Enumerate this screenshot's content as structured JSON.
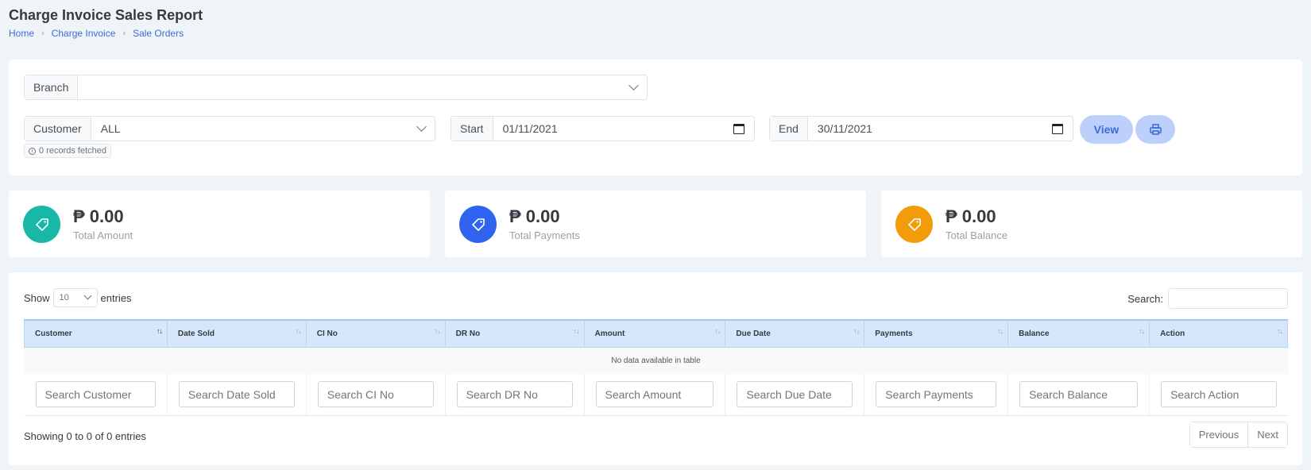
{
  "header": {
    "title": "Charge Invoice Sales Report",
    "breadcrumb": [
      "Home",
      "Charge Invoice",
      "Sale Orders"
    ]
  },
  "filters": {
    "branch": {
      "label": "Branch",
      "value": ""
    },
    "customer": {
      "label": "Customer",
      "value": "ALL"
    },
    "start": {
      "label": "Start",
      "value": "01/11/2021"
    },
    "end": {
      "label": "End",
      "value": "30/11/2021"
    },
    "records_badge": "0 records fetched",
    "view_label": "View",
    "print_icon": "printer-icon"
  },
  "stats": [
    {
      "value": "₱ 0.00",
      "label": "Total Amount",
      "color": "#17b8a8",
      "icon": "tag-icon"
    },
    {
      "value": "₱ 0.00",
      "label": "Total Payments",
      "color": "#2f63f0",
      "icon": "tag-icon"
    },
    {
      "value": "₱ 0.00",
      "label": "Total Balance",
      "color": "#f29c0b",
      "icon": "tag-icon"
    }
  ],
  "table": {
    "show_label": "Show",
    "entries_label": "entries",
    "length_value": "10",
    "search_label": "Search:",
    "columns": [
      "Customer",
      "Date Sold",
      "CI No",
      "DR No",
      "Amount",
      "Due Date",
      "Payments",
      "Balance",
      "Action"
    ],
    "empty_message": "No data available in table",
    "filter_placeholders": [
      "Search Customer",
      "Search Date Sold",
      "Search CI No",
      "Search DR No",
      "Search Amount",
      "Search Due Date",
      "Search Payments",
      "Search Balance",
      "Search Action"
    ],
    "info": "Showing 0 to 0 of 0 entries",
    "previous_label": "Previous",
    "next_label": "Next"
  }
}
